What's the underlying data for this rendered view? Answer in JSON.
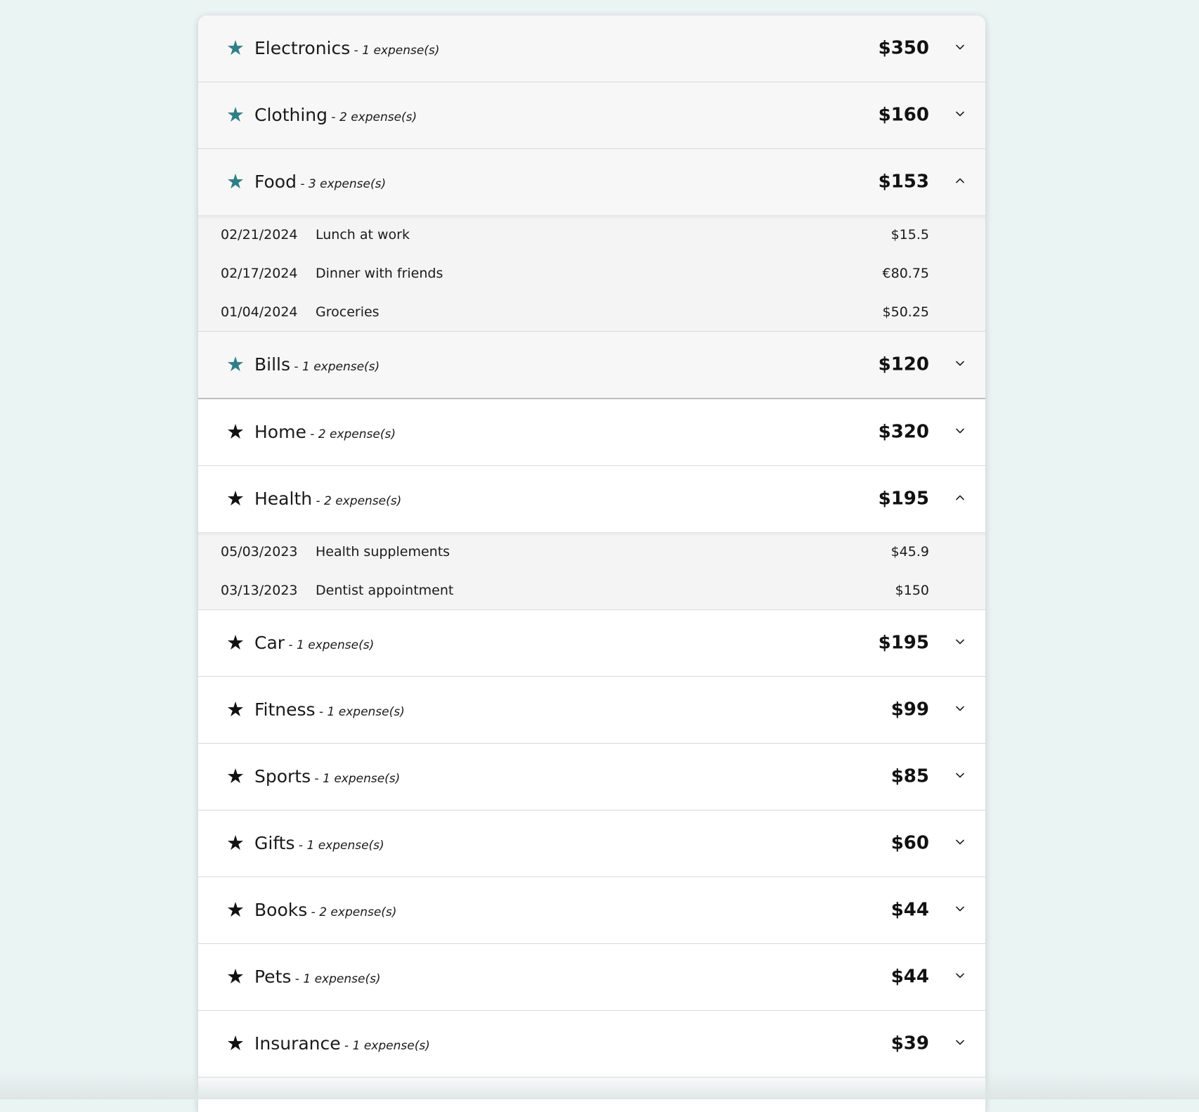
{
  "separator": " - ",
  "colors": {
    "background": "#eaf4f3",
    "starred_accent": "#2f7f86",
    "default_star": "#111111"
  },
  "categories": [
    {
      "name": "Electronics",
      "count_label": "1 expense(s)",
      "total": "$350",
      "starred": true,
      "expanded": false,
      "expenses": []
    },
    {
      "name": "Clothing",
      "count_label": "2 expense(s)",
      "total": "$160",
      "starred": true,
      "expanded": false,
      "expenses": []
    },
    {
      "name": "Food",
      "count_label": "3 expense(s)",
      "total": "$153",
      "starred": true,
      "expanded": true,
      "expenses": [
        {
          "date": "02/21/2024",
          "description": "Lunch at work",
          "amount": "$15.5"
        },
        {
          "date": "02/17/2024",
          "description": "Dinner with friends",
          "amount": "€80.75"
        },
        {
          "date": "01/04/2024",
          "description": "Groceries",
          "amount": "$50.25"
        }
      ]
    },
    {
      "name": "Bills",
      "count_label": "1 expense(s)",
      "total": "$120",
      "starred": true,
      "expanded": false,
      "expenses": []
    },
    {
      "name": "Home",
      "count_label": "2 expense(s)",
      "total": "$320",
      "starred": false,
      "expanded": false,
      "expenses": []
    },
    {
      "name": "Health",
      "count_label": "2 expense(s)",
      "total": "$195",
      "starred": false,
      "expanded": true,
      "expenses": [
        {
          "date": "05/03/2023",
          "description": "Health supplements",
          "amount": "$45.9"
        },
        {
          "date": "03/13/2023",
          "description": "Dentist appointment",
          "amount": "$150"
        }
      ]
    },
    {
      "name": "Car",
      "count_label": "1 expense(s)",
      "total": "$195",
      "starred": false,
      "expanded": false,
      "expenses": []
    },
    {
      "name": "Fitness",
      "count_label": "1 expense(s)",
      "total": "$99",
      "starred": false,
      "expanded": false,
      "expenses": []
    },
    {
      "name": "Sports",
      "count_label": "1 expense(s)",
      "total": "$85",
      "starred": false,
      "expanded": false,
      "expenses": []
    },
    {
      "name": "Gifts",
      "count_label": "1 expense(s)",
      "total": "$60",
      "starred": false,
      "expanded": false,
      "expenses": []
    },
    {
      "name": "Books",
      "count_label": "2 expense(s)",
      "total": "$44",
      "starred": false,
      "expanded": false,
      "expenses": []
    },
    {
      "name": "Pets",
      "count_label": "1 expense(s)",
      "total": "$44",
      "starred": false,
      "expanded": false,
      "expenses": []
    },
    {
      "name": "Insurance",
      "count_label": "1 expense(s)",
      "total": "$39",
      "starred": false,
      "expanded": false,
      "expenses": []
    }
  ]
}
